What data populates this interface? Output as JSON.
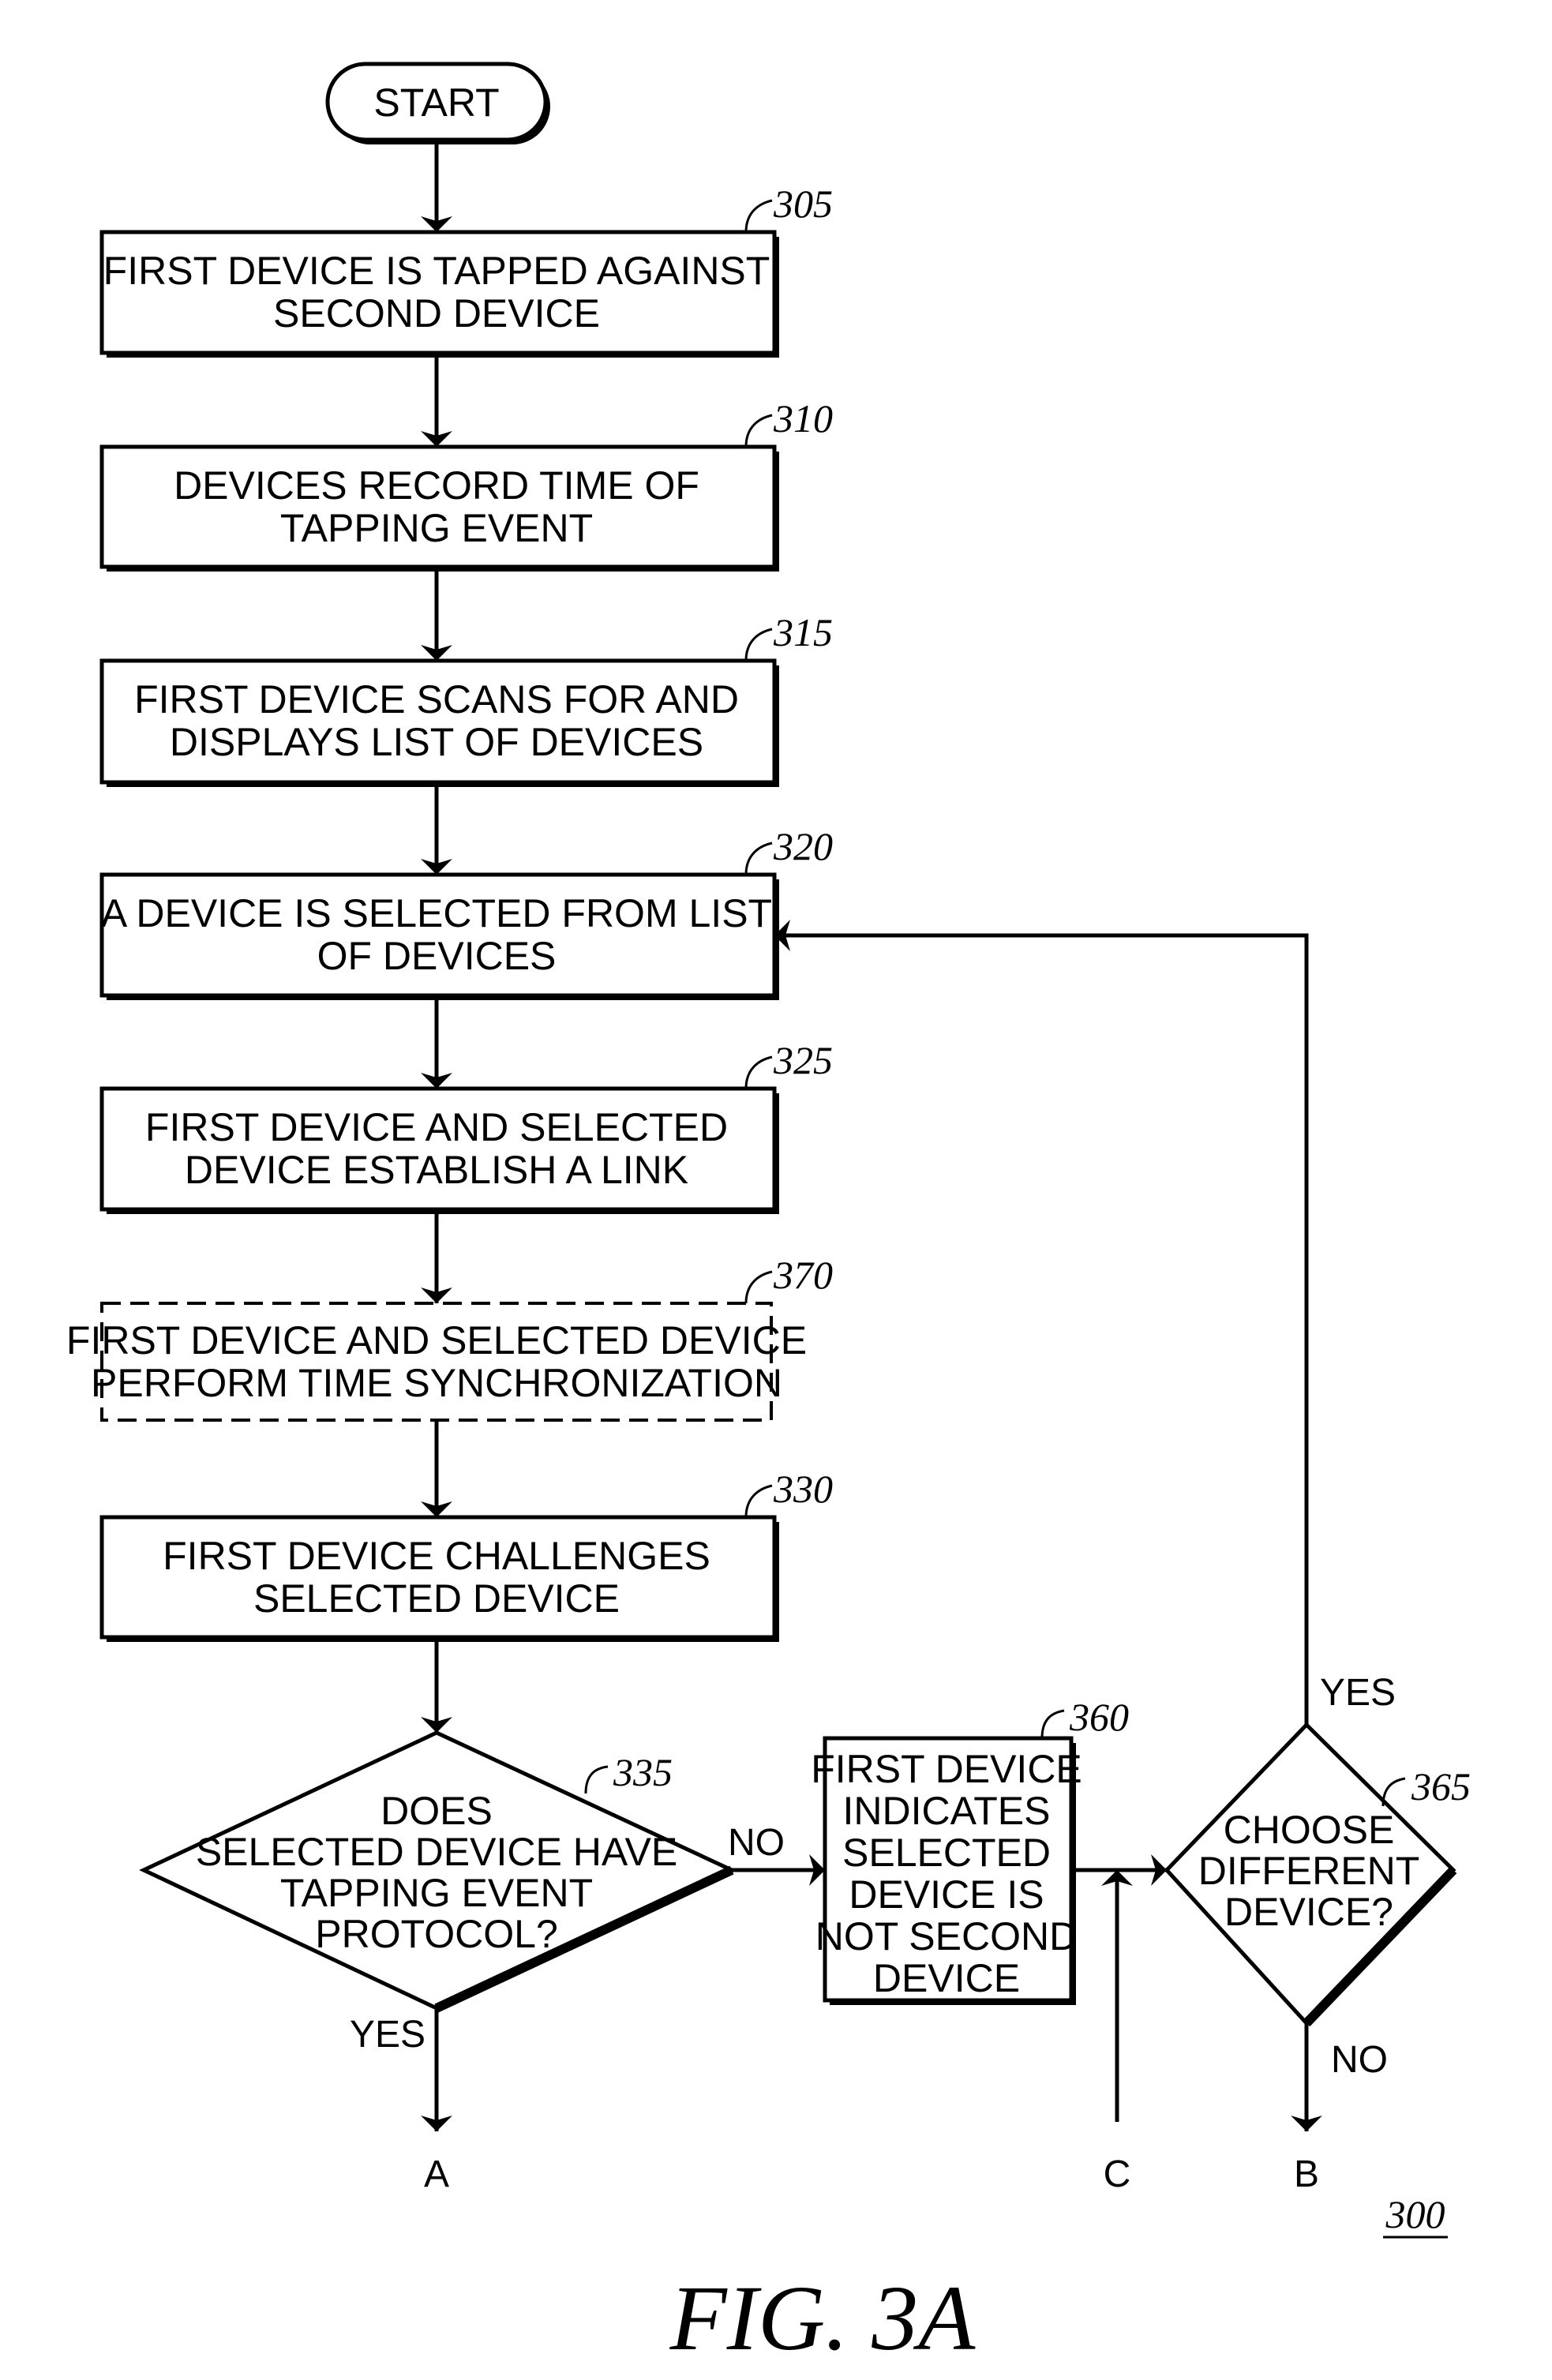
{
  "figure": {
    "caption": "FIG. 3A",
    "reference_number": "300"
  },
  "start": {
    "label": "START"
  },
  "steps": [
    {
      "id": "305",
      "lines": [
        "FIRST DEVICE IS TAPPED AGAINST",
        "SECOND DEVICE"
      ],
      "style": "solid"
    },
    {
      "id": "310",
      "lines": [
        "DEVICES RECORD TIME OF",
        "TAPPING EVENT"
      ],
      "style": "solid"
    },
    {
      "id": "315",
      "lines": [
        "FIRST DEVICE SCANS FOR AND",
        "DISPLAYS LIST OF DEVICES"
      ],
      "style": "solid"
    },
    {
      "id": "320",
      "lines": [
        "A DEVICE IS SELECTED FROM LIST",
        "OF DEVICES"
      ],
      "style": "solid"
    },
    {
      "id": "325",
      "lines": [
        "FIRST DEVICE AND SELECTED",
        "DEVICE ESTABLISH A LINK"
      ],
      "style": "solid"
    },
    {
      "id": "370",
      "lines": [
        "FIRST DEVICE AND SELECTED DEVICE",
        "PERFORM TIME SYNCHRONIZATION"
      ],
      "style": "dashed"
    },
    {
      "id": "330",
      "lines": [
        "FIRST DEVICE CHALLENGES",
        "SELECTED DEVICE"
      ],
      "style": "solid"
    }
  ],
  "decisions": [
    {
      "id": "335",
      "lines": [
        "DOES",
        "SELECTED DEVICE HAVE",
        "TAPPING EVENT",
        "PROTOCOL?"
      ],
      "yes_label": "YES",
      "no_label": "NO"
    },
    {
      "id": "365",
      "lines": [
        "CHOOSE",
        "DIFFERENT",
        "DEVICE?"
      ],
      "yes_label": "YES",
      "no_label": "NO"
    }
  ],
  "side_step": {
    "id": "360",
    "lines": [
      "FIRST DEVICE",
      "INDICATES",
      "SELECTED",
      "DEVICE IS",
      "NOT SECOND",
      "DEVICE"
    ]
  },
  "connectors": {
    "a": "A",
    "b": "B",
    "c": "C"
  }
}
